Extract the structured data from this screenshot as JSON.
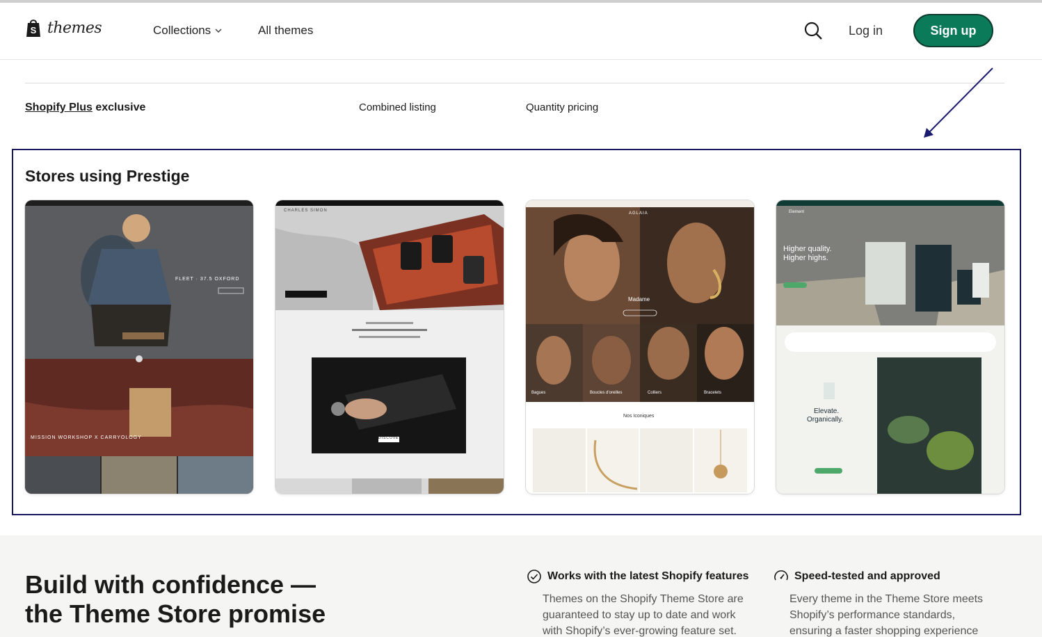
{
  "header": {
    "logo_text": "themes",
    "nav": {
      "collections": "Collections",
      "all_themes": "All themes"
    },
    "login": "Log in",
    "signup": "Sign up"
  },
  "features": {
    "plus_link": "Shopify Plus",
    "plus_suffix": "exclusive",
    "combined": "Combined listing",
    "quantity": "Quantity pricing"
  },
  "stores": {
    "title": "Stores using Prestige",
    "cards": [
      {
        "hero_text": "FLEET · 37.5 OXFORD",
        "banner_text": "MISSION WORKSHOP X CARRYOLOGY"
      },
      {
        "brand": "CHARLES SIMON",
        "cta": "DISCOVER"
      },
      {
        "brand": "AGLAIA",
        "hero_label": "Madame",
        "categories": [
          "Bagues",
          "Boucles d'oreilles",
          "Colliers",
          "Bracelets"
        ],
        "section": "Nos Iconiques"
      },
      {
        "brand": "Element",
        "headline_1": "Higher quality.",
        "headline_2": "Higher highs.",
        "tagline_1": "Elevate.",
        "tagline_2": "Organically."
      }
    ]
  },
  "promise": {
    "title_line1": "Build with confidence —",
    "title_line2": "the Theme Store promise",
    "items": [
      {
        "title": "Works with the latest Shopify features",
        "lines": [
          "Themes on the Shopify Theme Store are",
          "guaranteed to stay up to date and work",
          "with Shopify’s ever-growing feature set."
        ]
      },
      {
        "title": "Speed-tested and approved",
        "lines": [
          "Every theme in the Theme Store meets",
          "Shopify’s performance standards,",
          "ensuring a faster shopping experience"
        ]
      }
    ]
  },
  "colors": {
    "primary": "#0a7a58",
    "highlight_box": "#17175e",
    "arrow": "#1a1a6e"
  }
}
